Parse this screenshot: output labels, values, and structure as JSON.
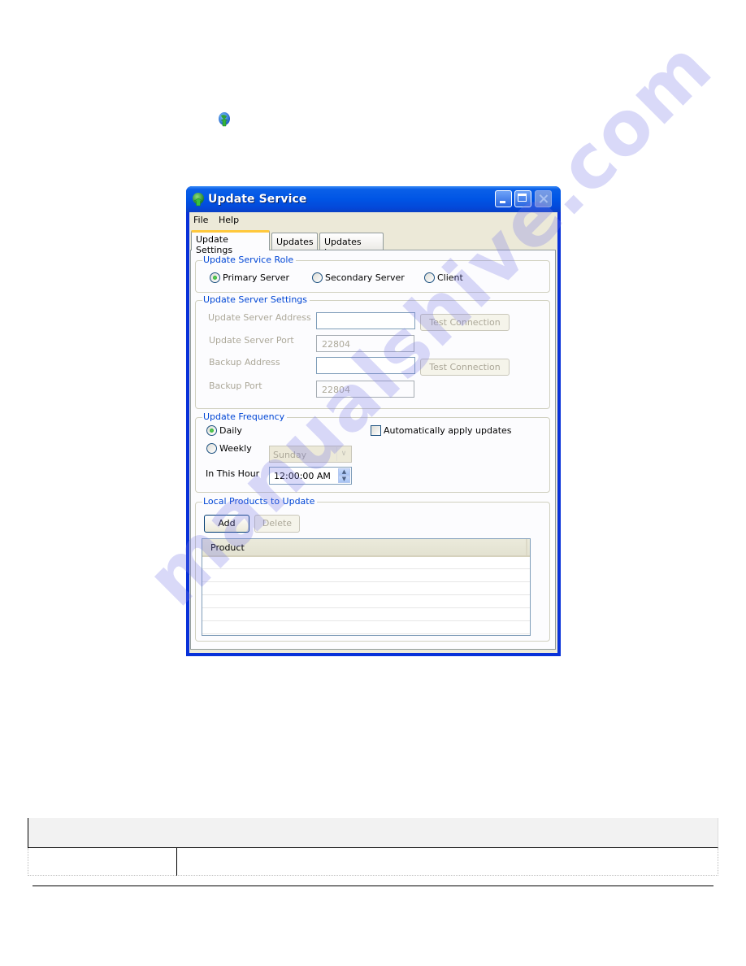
{
  "window": {
    "title": "Update Service",
    "menu": [
      "File",
      "Help"
    ],
    "tabs": [
      {
        "label": "Update Settings",
        "active": true
      },
      {
        "label": "Updates",
        "active": false
      },
      {
        "label": "Updates Log",
        "active": false
      }
    ]
  },
  "role_group": {
    "title": "Update Service Role",
    "options": [
      {
        "label": "Primary Server",
        "checked": true
      },
      {
        "label": "Secondary Server",
        "checked": false
      },
      {
        "label": "Client",
        "checked": false
      }
    ]
  },
  "server_group": {
    "title": "Update Server Settings",
    "address_label": "Update Server Address",
    "address_value": "",
    "port_label": "Update Server Port",
    "port_value": "22804",
    "backup_address_label": "Backup Address",
    "backup_address_value": "",
    "backup_port_label": "Backup Port",
    "backup_port_value": "22804",
    "test_connection_label": "Test Connection"
  },
  "frequency_group": {
    "title": "Update Frequency",
    "daily_label": "Daily",
    "daily_checked": true,
    "weekly_label": "Weekly",
    "weekly_checked": false,
    "weekday_value": "Sunday",
    "auto_apply_label": "Automatically apply updates",
    "auto_apply_checked": false,
    "hour_label": "In This Hour",
    "hour_value": "12:00:00 AM"
  },
  "products_group": {
    "title": "Local Products to Update",
    "add_label": "Add",
    "delete_label": "Delete",
    "column_header": "Product",
    "rows": []
  },
  "watermark": "manualshive.com",
  "colors": {
    "titlebar": "#0055e5",
    "group_title": "#0046d5",
    "dialog_bg": "#ece9d8",
    "tab_highlight": "#ffc83c"
  }
}
